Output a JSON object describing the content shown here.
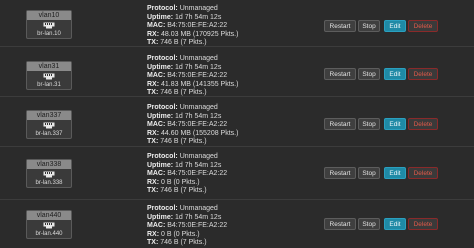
{
  "labels": {
    "protocol": "Protocol:",
    "uptime": "Uptime:",
    "mac": "MAC:",
    "rx": "RX:",
    "tx": "TX:"
  },
  "buttons": {
    "restart": "Restart",
    "stop": "Stop",
    "edit": "Edit",
    "delete": "Delete"
  },
  "colors": {
    "background": "#2b2b2b",
    "edit_button": "#1f8aa6",
    "delete_text": "#e05a4a"
  },
  "interfaces": [
    {
      "name": "vlan10",
      "device": "br-lan.10",
      "icon": "ethernet-port-icon",
      "protocol": "Unmanaged",
      "uptime": "1d 7h 54m 12s",
      "mac": "B4:75:0E:FE:A2:22",
      "rx": "48.03 MB (170925 Pkts.)",
      "tx": "746 B (7 Pkts.)"
    },
    {
      "name": "vlan31",
      "device": "br-lan.31",
      "icon": "ethernet-port-icon",
      "protocol": "Unmanaged",
      "uptime": "1d 7h 54m 12s",
      "mac": "B4:75:0E:FE:A2:22",
      "rx": "41.83 MB (141355 Pkts.)",
      "tx": "746 B (7 Pkts.)"
    },
    {
      "name": "vlan337",
      "device": "br-lan.337",
      "icon": "ethernet-port-icon",
      "protocol": "Unmanaged",
      "uptime": "1d 7h 54m 12s",
      "mac": "B4:75:0E:FE:A2:22",
      "rx": "44.60 MB (155208 Pkts.)",
      "tx": "746 B (7 Pkts.)"
    },
    {
      "name": "vlan338",
      "device": "br-lan.338",
      "icon": "ethernet-port-icon",
      "protocol": "Unmanaged",
      "uptime": "1d 7h 54m 12s",
      "mac": "B4:75:0E:FE:A2:22",
      "rx": "0 B (0 Pkts.)",
      "tx": "746 B (7 Pkts.)"
    },
    {
      "name": "vlan440",
      "device": "br-lan.440",
      "icon": "ethernet-port-icon",
      "protocol": "Unmanaged",
      "uptime": "1d 7h 54m 12s",
      "mac": "B4:75:0E:FE:A2:22",
      "rx": "0 B (0 Pkts.)",
      "tx": "746 B (7 Pkts.)"
    }
  ]
}
